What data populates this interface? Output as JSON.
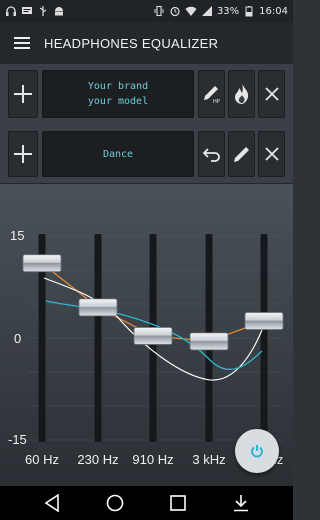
{
  "status_bar": {
    "battery": "33%",
    "time": "16:04",
    "left_icons": [
      "headphones-icon",
      "message-icon",
      "usb-icon",
      "android-icon"
    ],
    "right_icons": [
      "vibrate-icon",
      "alarm-icon",
      "wifi-icon",
      "signal-icon",
      "battery-icon"
    ]
  },
  "app_bar": {
    "title": "HEADPHONES EQUALIZER",
    "menu_icon": "menu-icon"
  },
  "headphone_row": {
    "lcd_line1": "Your brand",
    "lcd_line2": "your model",
    "buttons": [
      "add-icon",
      "pencil-hp-icon",
      "flame-icon",
      "close-icon"
    ],
    "pencil_badge": "HP"
  },
  "preset_row": {
    "lcd_text": "Dance",
    "buttons": [
      "add-icon",
      "undo-icon",
      "pencil-icon",
      "close-icon"
    ]
  },
  "equalizer": {
    "db_max": "15",
    "db_mid": "0",
    "db_min": "-15",
    "bands": [
      {
        "label": "60 Hz",
        "gain_db": 11
      },
      {
        "label": "230 Hz",
        "gain_db": 4.5
      },
      {
        "label": "910 Hz",
        "gain_db": 0.3
      },
      {
        "label": "3 kHz",
        "gain_db": -0.5
      },
      {
        "label": "14 kHz",
        "gain_db": 2.5
      }
    ],
    "colors": {
      "curve_orange": "#e08a3a",
      "curve_white": "#ffffff",
      "curve_cyan": "#2fb5cf",
      "track": "#15191c"
    }
  },
  "fab": {
    "icon": "power-icon",
    "color": "#2fb5cf"
  },
  "nav_bar": {
    "buttons": [
      "back-icon",
      "home-icon",
      "recents-icon",
      "download-icon"
    ]
  }
}
